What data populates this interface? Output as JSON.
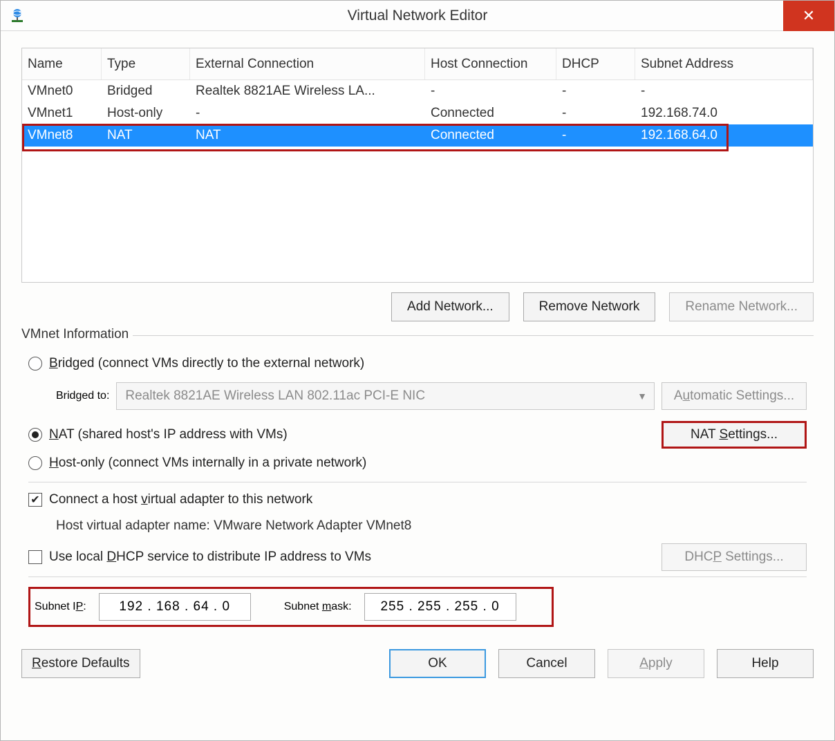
{
  "titlebar": {
    "title": "Virtual Network Editor",
    "close": "✕"
  },
  "table": {
    "headers": {
      "name": "Name",
      "type": "Type",
      "ext": "External Connection",
      "host": "Host Connection",
      "dhcp": "DHCP",
      "subnet": "Subnet Address"
    },
    "rows": [
      {
        "name": "VMnet0",
        "type": "Bridged",
        "ext": "Realtek 8821AE Wireless LA...",
        "host": "-",
        "dhcp": "-",
        "subnet": "-",
        "selected": false
      },
      {
        "name": "VMnet1",
        "type": "Host-only",
        "ext": "-",
        "host": "Connected",
        "dhcp": "-",
        "subnet": "192.168.74.0",
        "selected": false
      },
      {
        "name": "VMnet8",
        "type": "NAT",
        "ext": "NAT",
        "host": "Connected",
        "dhcp": "-",
        "subnet": "192.168.64.0",
        "selected": true
      }
    ]
  },
  "buttons": {
    "add": "Add Network...",
    "remove": "Remove Network",
    "rename": "Rename Network..."
  },
  "info": {
    "legend": "VMnet Information",
    "bridged_pre": "B",
    "bridged_mid": "ridged (connect VMs directly to the external network)",
    "bridged_to_label": "Bridged to:",
    "bridged_to_value": "Realtek 8821AE Wireless LAN 802.11ac PCI-E NIC",
    "auto_btn_pre": "A",
    "auto_btn_mid": "u",
    "auto_btn_post": "tomatic Settings...",
    "nat_pre": "N",
    "nat_post": "AT (shared host's IP address with VMs)",
    "nat_btn_pre": "NAT ",
    "nat_btn_u": "S",
    "nat_btn_post": "ettings...",
    "host_pre": "H",
    "host_post": "ost-only (connect VMs internally in a private network)",
    "conn_pre": "Connect a host ",
    "conn_u": "v",
    "conn_post": "irtual adapter to this network",
    "host_name_label": "Host virtual adapter name: ",
    "host_name_value": "VMware Network Adapter VMnet8",
    "dhcp_pre": "Use local ",
    "dhcp_u": "D",
    "dhcp_post": "HCP service to distribute IP address to VMs",
    "dhcp_btn_pre": "DHC",
    "dhcp_btn_u": "P",
    "dhcp_btn_post": " Settings...",
    "subnet_ip_pre": "Subnet I",
    "subnet_ip_u": "P",
    "subnet_ip_post": ":",
    "subnet_ip_value": "192 . 168 .  64  .  0",
    "subnet_mask_pre": "Subnet ",
    "subnet_mask_u": "m",
    "subnet_mask_post": "ask:",
    "subnet_mask_value": "255 . 255 . 255 .  0"
  },
  "footer": {
    "restore_u": "R",
    "restore_post": "estore Defaults",
    "ok": "OK",
    "cancel": "Cancel",
    "apply_u": "A",
    "apply_post": "pply",
    "help": "Help"
  }
}
